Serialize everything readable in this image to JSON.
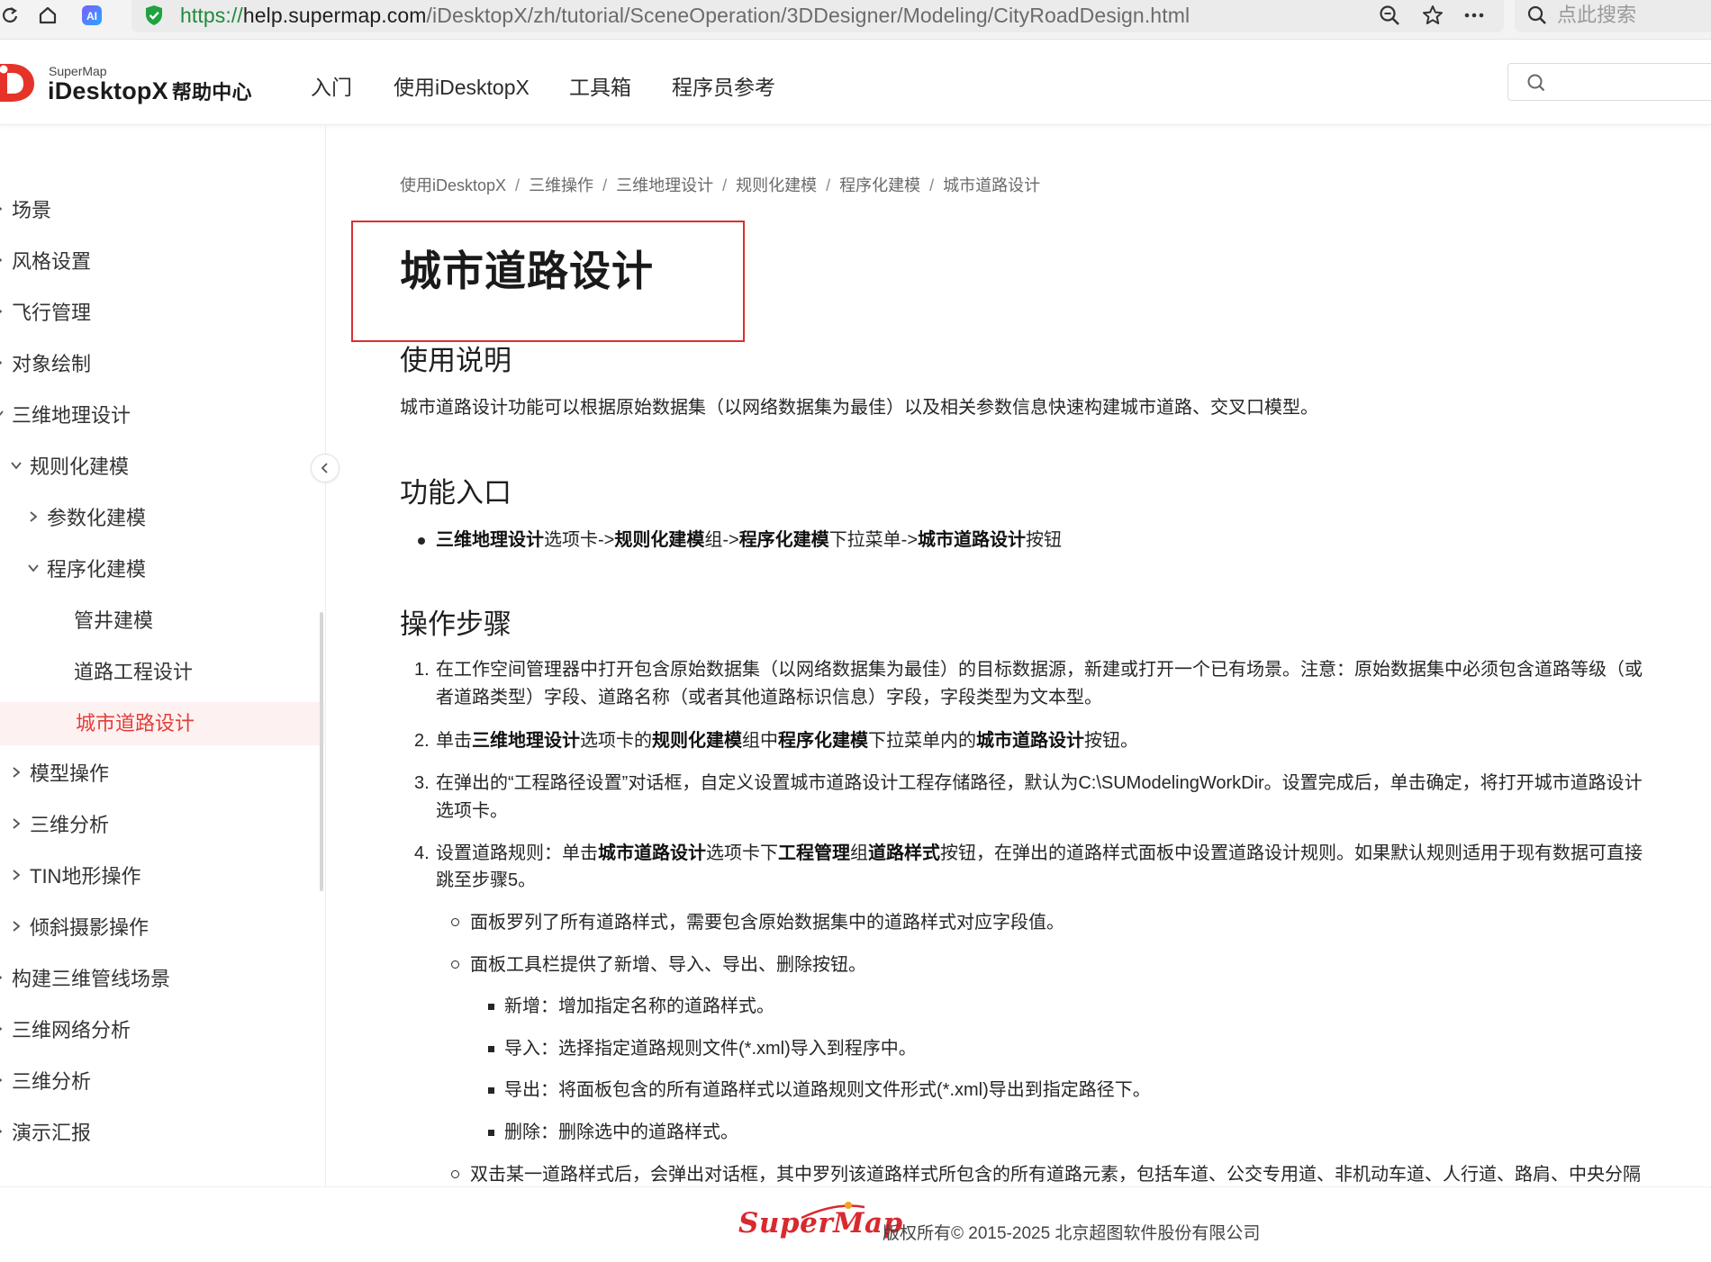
{
  "browser": {
    "url_proto": "https://",
    "url_host": "help.supermap.com",
    "url_path": "/iDesktopX/zh/tutorial/SceneOperation/3DDesigner/Modeling/CityRoadDesign.html",
    "search_placeholder": "点此搜索"
  },
  "header": {
    "brand_small": "SuperMap",
    "brand_main": "iDesktopX",
    "brand_suffix": "帮助中心",
    "nav": [
      "入门",
      "使用iDesktopX",
      "工具箱",
      "程序员参考"
    ]
  },
  "sidebar": {
    "items": [
      {
        "label": "场景"
      },
      {
        "label": "风格设置"
      },
      {
        "label": "飞行管理"
      },
      {
        "label": "对象绘制"
      },
      {
        "label": "三维地理设计"
      },
      {
        "label": "规则化建模"
      },
      {
        "label": "参数化建模"
      },
      {
        "label": "程序化建模"
      },
      {
        "label": "管井建模"
      },
      {
        "label": "道路工程设计"
      },
      {
        "label": "城市道路设计"
      },
      {
        "label": "模型操作"
      },
      {
        "label": "三维分析"
      },
      {
        "label": "TIN地形操作"
      },
      {
        "label": "倾斜摄影操作"
      },
      {
        "label": "构建三维管线场景"
      },
      {
        "label": "三维网络分析"
      },
      {
        "label": "三维分析"
      },
      {
        "label": "演示汇报"
      }
    ]
  },
  "breadcrumb": [
    "使用iDesktopX",
    "三维操作",
    "三维地理设计",
    "规则化建模",
    "程序化建模",
    "城市道路设计"
  ],
  "content": {
    "title": "城市道路设计",
    "usage_heading": "使用说明",
    "usage_text": "城市道路设计功能可以根据原始数据集（以网络数据集为最佳）以及相关参数信息快速构建城市道路、交叉口模型。",
    "entry_heading": "功能入口",
    "entry": {
      "b1": "三维地理设计",
      "t1": "选项卡->",
      "b2": "规则化建模",
      "t2": "组->",
      "b3": "程序化建模",
      "t3": "下拉菜单->",
      "b4": "城市道路设计",
      "t4": "按钮"
    },
    "steps_heading": "操作步骤",
    "steps": {
      "s1_line1": "在工作空间管理器中打开包含原始数据集（以网络数据集为最佳）的目标数据源，新建或打开一个已有场景。注意：原始数据集中必须包含道路等级（或",
      "s1_line2": "者道路类型）字段、道路名称（或者其他道路标识信息）字段，字段类型为文本型。",
      "s2_t1": "单击",
      "s2_b1": "三维地理设计",
      "s2_t2": "选项卡的",
      "s2_b2": "规则化建模",
      "s2_t3": "组中",
      "s2_b3": "程序化建模",
      "s2_t4": "下拉菜单内的",
      "s2_b4": "城市道路设计",
      "s2_t5": "按钮。",
      "s3_line1": "在弹出的“工程路径设置”对话框，自定义设置城市道路设计工程存储路径，默认为C:\\SUModelingWorkDir。设置完成后，单击确定，将打开城市道路设计",
      "s3_line2": "选项卡。",
      "s4_t1": "设置道路规则：单击",
      "s4_b1": "城市道路设计",
      "s4_t2": "选项卡下",
      "s4_b2": "工程管理",
      "s4_t3": "组",
      "s4_b3": "道路样式",
      "s4_t4": "按钮，在弹出的道路样式面板中设置道路设计规则。如果默认规则适用于现有数据可直接",
      "s4_line2": "跳至步骤5。",
      "sub1": "面板罗列了所有道路样式，需要包含原始数据集中的道路样式对应字段值。",
      "sub2": "面板工具栏提供了新增、导入、导出、删除按钮。",
      "sq1": "新增：增加指定名称的道路样式。",
      "sq2": "导入：选择指定道路规则文件(*.xml)导入到程序中。",
      "sq3": "导出：将面板包含的所有道路样式以道路规则文件形式(*.xml)导出到指定路径下。",
      "sq4": "删除：删除选中的道路样式。",
      "sub3": "双击某一道路样式后，会弹出对话框，其中罗列该道路样式所包含的所有道路元素，包括车道、公交专用道、非机动车道、人行道、路肩、中央分隔"
    },
    "step_numbers": [
      "1.",
      "2.",
      "3.",
      "4."
    ]
  },
  "footer": {
    "logo": "SuperMap",
    "copyright": "版权所有© 2015-2025 北京超图软件股份有限公司"
  },
  "colors": {
    "accent": "#e2403a",
    "highlight_border": "#d9302f",
    "active_bg": "#fdf1f1"
  }
}
